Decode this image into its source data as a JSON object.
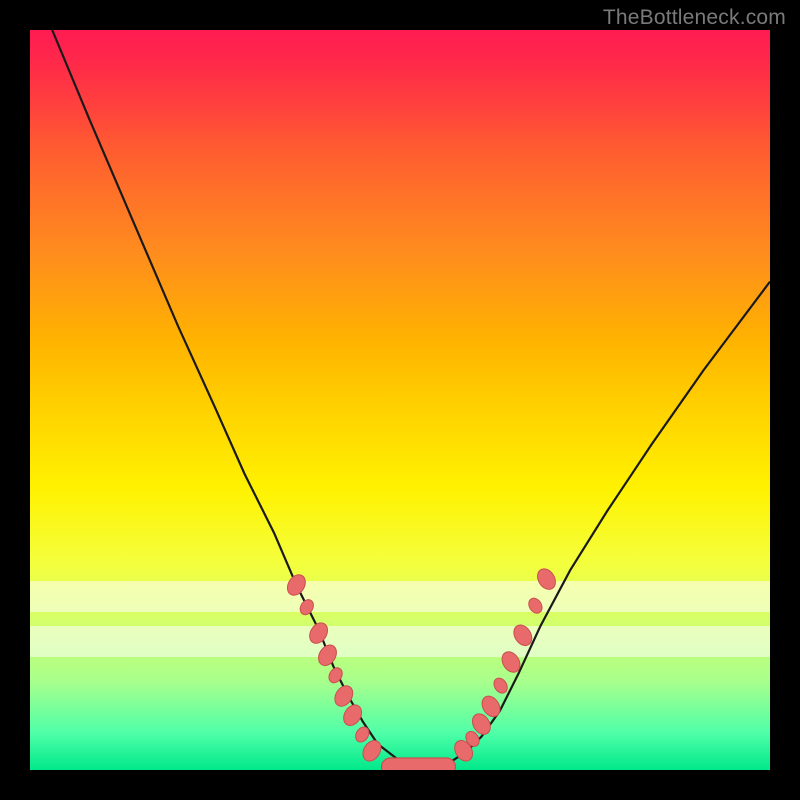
{
  "watermark": "TheBottleneck.com",
  "colors": {
    "gradient_top": "#ff1a4d",
    "gradient_bottom": "#00e88a",
    "marker": "#e86a6a",
    "curve": "#1a1a1a"
  },
  "chart_data": {
    "type": "line",
    "title": "",
    "xlabel": "",
    "ylabel": "",
    "xlim": [
      0,
      100
    ],
    "ylim": [
      0,
      100
    ],
    "grid": false,
    "legend": false,
    "series": [
      {
        "name": "curve",
        "x": [
          3,
          8,
          14,
          20,
          25,
          29,
          33,
          36,
          39,
          41,
          43,
          45,
          47,
          50,
          53,
          55,
          57,
          59,
          61,
          63.5,
          66,
          69,
          73,
          78,
          84,
          91,
          100
        ],
        "y": [
          100,
          88,
          74,
          60,
          49,
          40,
          32,
          25,
          19,
          14,
          10,
          6.5,
          3.5,
          1.2,
          0.4,
          0.5,
          1.2,
          2.5,
          4.5,
          8,
          13,
          19.5,
          27,
          35,
          44,
          54,
          66
        ]
      }
    ],
    "markers_left": [
      {
        "x": 36.0,
        "y": 25.0
      },
      {
        "x": 37.4,
        "y": 22.0
      },
      {
        "x": 39.0,
        "y": 18.5
      },
      {
        "x": 40.2,
        "y": 15.5
      },
      {
        "x": 41.3,
        "y": 12.8
      },
      {
        "x": 42.4,
        "y": 10.0
      },
      {
        "x": 43.6,
        "y": 7.4
      },
      {
        "x": 44.9,
        "y": 4.8
      },
      {
        "x": 46.2,
        "y": 2.6
      }
    ],
    "markers_right": [
      {
        "x": 58.6,
        "y": 2.6
      },
      {
        "x": 59.8,
        "y": 4.2
      },
      {
        "x": 61.0,
        "y": 6.2
      },
      {
        "x": 62.3,
        "y": 8.6
      },
      {
        "x": 63.6,
        "y": 11.4
      },
      {
        "x": 65.0,
        "y": 14.6
      },
      {
        "x": 66.6,
        "y": 18.2
      },
      {
        "x": 68.3,
        "y": 22.2
      },
      {
        "x": 69.8,
        "y": 25.8
      }
    ],
    "baseline_span": {
      "x0": 47.5,
      "x1": 57.5,
      "y": 0.4
    },
    "wash_bands": [
      {
        "y": 74.5,
        "height_pct": 4.2,
        "alpha": 0.55
      },
      {
        "y": 80.5,
        "height_pct": 4.2,
        "alpha": 0.55
      }
    ]
  }
}
